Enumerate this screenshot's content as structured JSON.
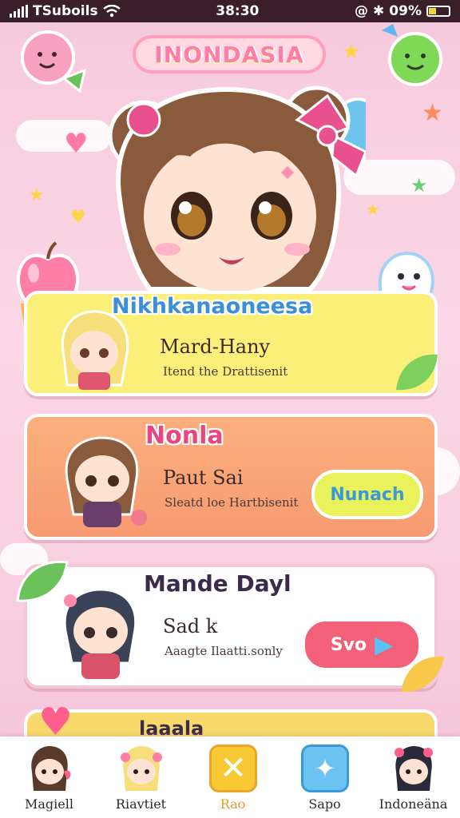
{
  "status_bar": {
    "carrier": "TSuboils",
    "time": "38:30",
    "battery": "09%"
  },
  "header": {
    "title": "INONDASIA"
  },
  "featured": {
    "title": "Nikhkanaoneesa"
  },
  "cards": [
    {
      "name": "Mard-Hany",
      "subtitle": "Itend the Drattisenit"
    },
    {
      "title": "Nonla",
      "name": "Paut Sai",
      "subtitle": "Sleatd loe Hartbisenit",
      "button": "Nunach"
    },
    {
      "title": "Mande Dayl",
      "name": "Sad k",
      "subtitle": "Aaagte Ilaatti.sonly",
      "button": "Svo"
    },
    {
      "title": "laaala"
    }
  ],
  "tabs": [
    {
      "label": "Magiell"
    },
    {
      "label": "Riavtiet"
    },
    {
      "label": "Rao"
    },
    {
      "label": "Sapo"
    },
    {
      "label": "Indoneäna"
    }
  ],
  "colors": {
    "accent_pink": "#ff7da6",
    "yellow_card": "#f9ef79",
    "orange_card": "#f79a72",
    "button_green": "#e9f25a",
    "button_red": "#f2607a"
  }
}
